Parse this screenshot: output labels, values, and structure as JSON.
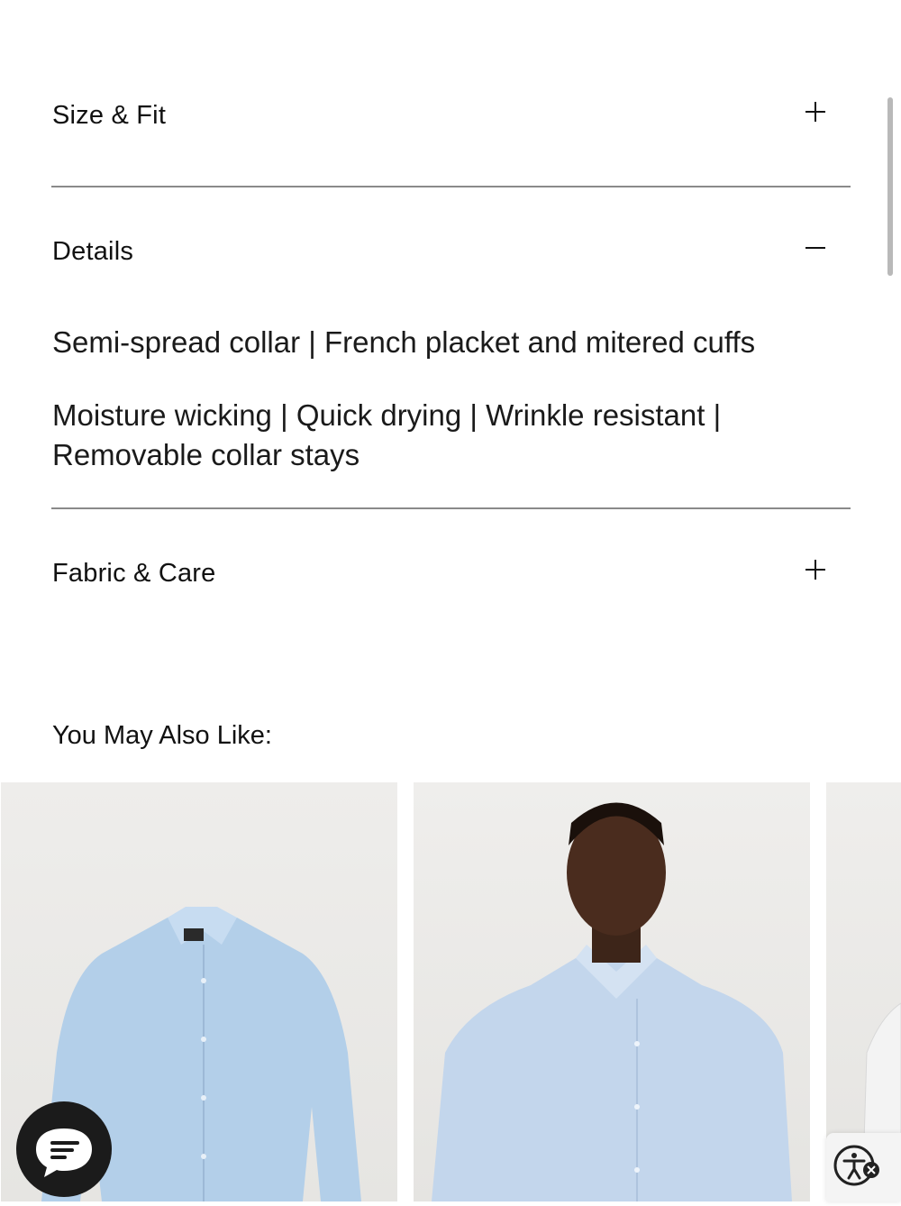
{
  "accordion": {
    "size_fit": {
      "title": "Size & Fit",
      "toggle_icon": "plus-icon"
    },
    "details": {
      "title": "Details",
      "toggle_icon": "minus-icon",
      "lines": [
        "Semi-spread collar | French placket and mitered cuffs",
        "Moisture wicking | Quick drying | Wrinkle resistant | Removable collar stays"
      ]
    },
    "fabric_care": {
      "title": "Fabric & Care",
      "toggle_icon": "plus-icon"
    }
  },
  "recommendations": {
    "title": "You May Also Like:",
    "products": [
      {
        "image": "light-blue-dress-shirt-flatlay",
        "color": "#b3cfe9"
      },
      {
        "image": "model-light-blue-dress-shirt",
        "color": "#c3d6ec"
      },
      {
        "image": "white-shirt-partial",
        "color": "#f3f3f3"
      }
    ]
  },
  "widgets": {
    "chat": {
      "icon": "chat-icon"
    },
    "accessibility": {
      "icon": "accessibility-icon"
    }
  }
}
